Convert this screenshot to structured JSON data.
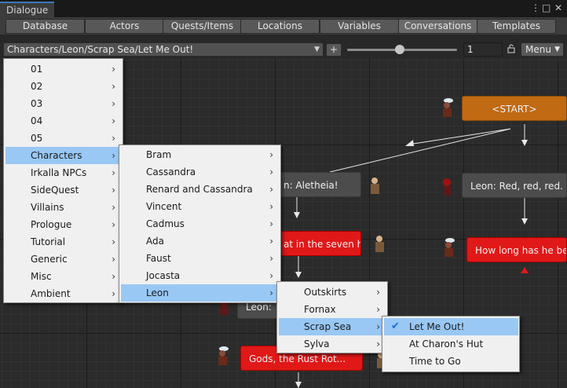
{
  "window": {
    "title": "Dialogue",
    "controls": [
      "⋮",
      "□",
      "✕"
    ]
  },
  "tabs": [
    {
      "label": "Database",
      "active": false
    },
    {
      "label": "Actors",
      "active": false
    },
    {
      "label": "Quests/Items",
      "active": false
    },
    {
      "label": "Locations",
      "active": false
    },
    {
      "label": "Variables",
      "active": false
    },
    {
      "label": "Conversations",
      "active": true
    },
    {
      "label": "Templates",
      "active": false
    }
  ],
  "toolbar": {
    "path": "Characters/Leon/Scrap Sea/Let Me Out!",
    "add_label": "+",
    "zoom_value": "1",
    "menu_label": "Menu"
  },
  "nodes": {
    "start": "<START>",
    "aletheia": "n: Aletheia!",
    "leon_red": "Leon: Red, red, red. \\,Y",
    "seven": "at in the seven he",
    "how_long": "How long has he been",
    "leon_small": "Leon: ",
    "gods": "Gods, the Rust Rot..."
  },
  "menus": {
    "level1": [
      "01",
      "02",
      "03",
      "04",
      "05",
      "Characters",
      "Irkalla NPCs",
      "SideQuest",
      "Villains",
      "Prologue",
      "Tutorial",
      "Generic",
      "Misc",
      "Ambient"
    ],
    "level2": [
      "Bram",
      "Cassandra",
      "Renard and Cassandra",
      "Vincent",
      "Cadmus",
      "Ada",
      "Faust",
      "Jocasta",
      "Leon"
    ],
    "level3": [
      "Outskirts",
      "Fornax",
      "Scrap Sea",
      "Sylva"
    ],
    "level4": [
      "Let Me Out!",
      "At Charon's Hut",
      "Time to Go"
    ]
  },
  "colors": {
    "accent_blue": "#3a79bb",
    "menu_highlight": "#99c8f5",
    "node_orange": "#c06a13",
    "node_red": "#e01818",
    "node_gray": "#4c4c4c"
  }
}
